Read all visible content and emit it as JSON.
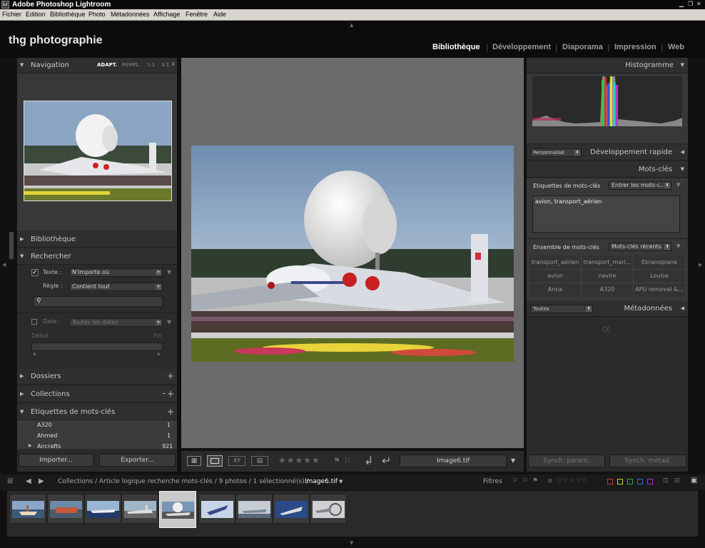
{
  "titlebar": {
    "title": "Adobe Photoshop Lightroom",
    "logo": "Lr"
  },
  "menu": [
    "Fichier",
    "Edition",
    "Bibliothèque",
    "Photo",
    "Métadonnées",
    "Affichage",
    "Fenêtre",
    "Aide"
  ],
  "identity": {
    "brand": "thg photographie",
    "modules": [
      "Bibliothèque",
      "Développement",
      "Diaporama",
      "Impression",
      "Web"
    ],
    "active_module": "Bibliothèque"
  },
  "left": {
    "navigation": {
      "title": "Navigation",
      "zoom": [
        "ADAPT.",
        "REMPL.",
        "1:1",
        "3:1"
      ]
    },
    "bibliotheque": {
      "title": "Bibliothèque"
    },
    "rechercher": {
      "title": "Rechercher",
      "texte_label": "Texte :",
      "texte_value": "N'importe où",
      "regle_label": "Règle :",
      "regle_value": "Contient tout",
      "date_label": "Date :",
      "date_value": "Toutes les dates",
      "debut": "Début",
      "fin": "Fin"
    },
    "dossiers": {
      "title": "Dossiers"
    },
    "collections": {
      "title": "Collections"
    },
    "etiquettes": {
      "title": "Etiquettes de mots-clés",
      "items": [
        {
          "name": "A320",
          "count": "1"
        },
        {
          "name": "Ahmed",
          "count": "1"
        },
        {
          "name": "Aircrafts",
          "count": "921"
        }
      ]
    },
    "import_label": "Importer...",
    "export_label": "Exporter..."
  },
  "right": {
    "histogramme": {
      "title": "Histogramme"
    },
    "dev_rapide": {
      "title": "Développement rapide",
      "preset": "Personnalisé"
    },
    "mots_cles": {
      "title": "Mots-clés",
      "etiquettes_label": "Etiquettes de mots-clés",
      "etiquettes_mode": "Entrer les mots-c...",
      "keywords": "avion, transport_aérien",
      "ensemble_label": "Ensemble de mots-clés",
      "ensemble_mode": "Mots-clés récents",
      "grid": [
        [
          "transport_aérien",
          "transport_mari...",
          "Ekranoplane"
        ],
        [
          "avion",
          "navire",
          "Louise"
        ],
        [
          "Anna",
          "A320",
          "APU removal &..."
        ]
      ]
    },
    "metadonnees": {
      "title": "Métadonnées",
      "preset": "Toutes"
    },
    "sync_param": "Synch. param.",
    "sync_metad": "Synch. métad."
  },
  "toolbar": {
    "filename": "Image6.tif"
  },
  "filmbar": {
    "path": "Collections / Article logique recherche mots-clés / 9 photos / 1 sélectionné(s) / ",
    "current": "Image6.tif",
    "filtres": "Filtres"
  },
  "filmstrip": {
    "count": 9,
    "selected_index": 4
  },
  "colors": {
    "accent": "#ffffff",
    "panel": "#2b2b2b",
    "center": "#6b6b6b"
  }
}
